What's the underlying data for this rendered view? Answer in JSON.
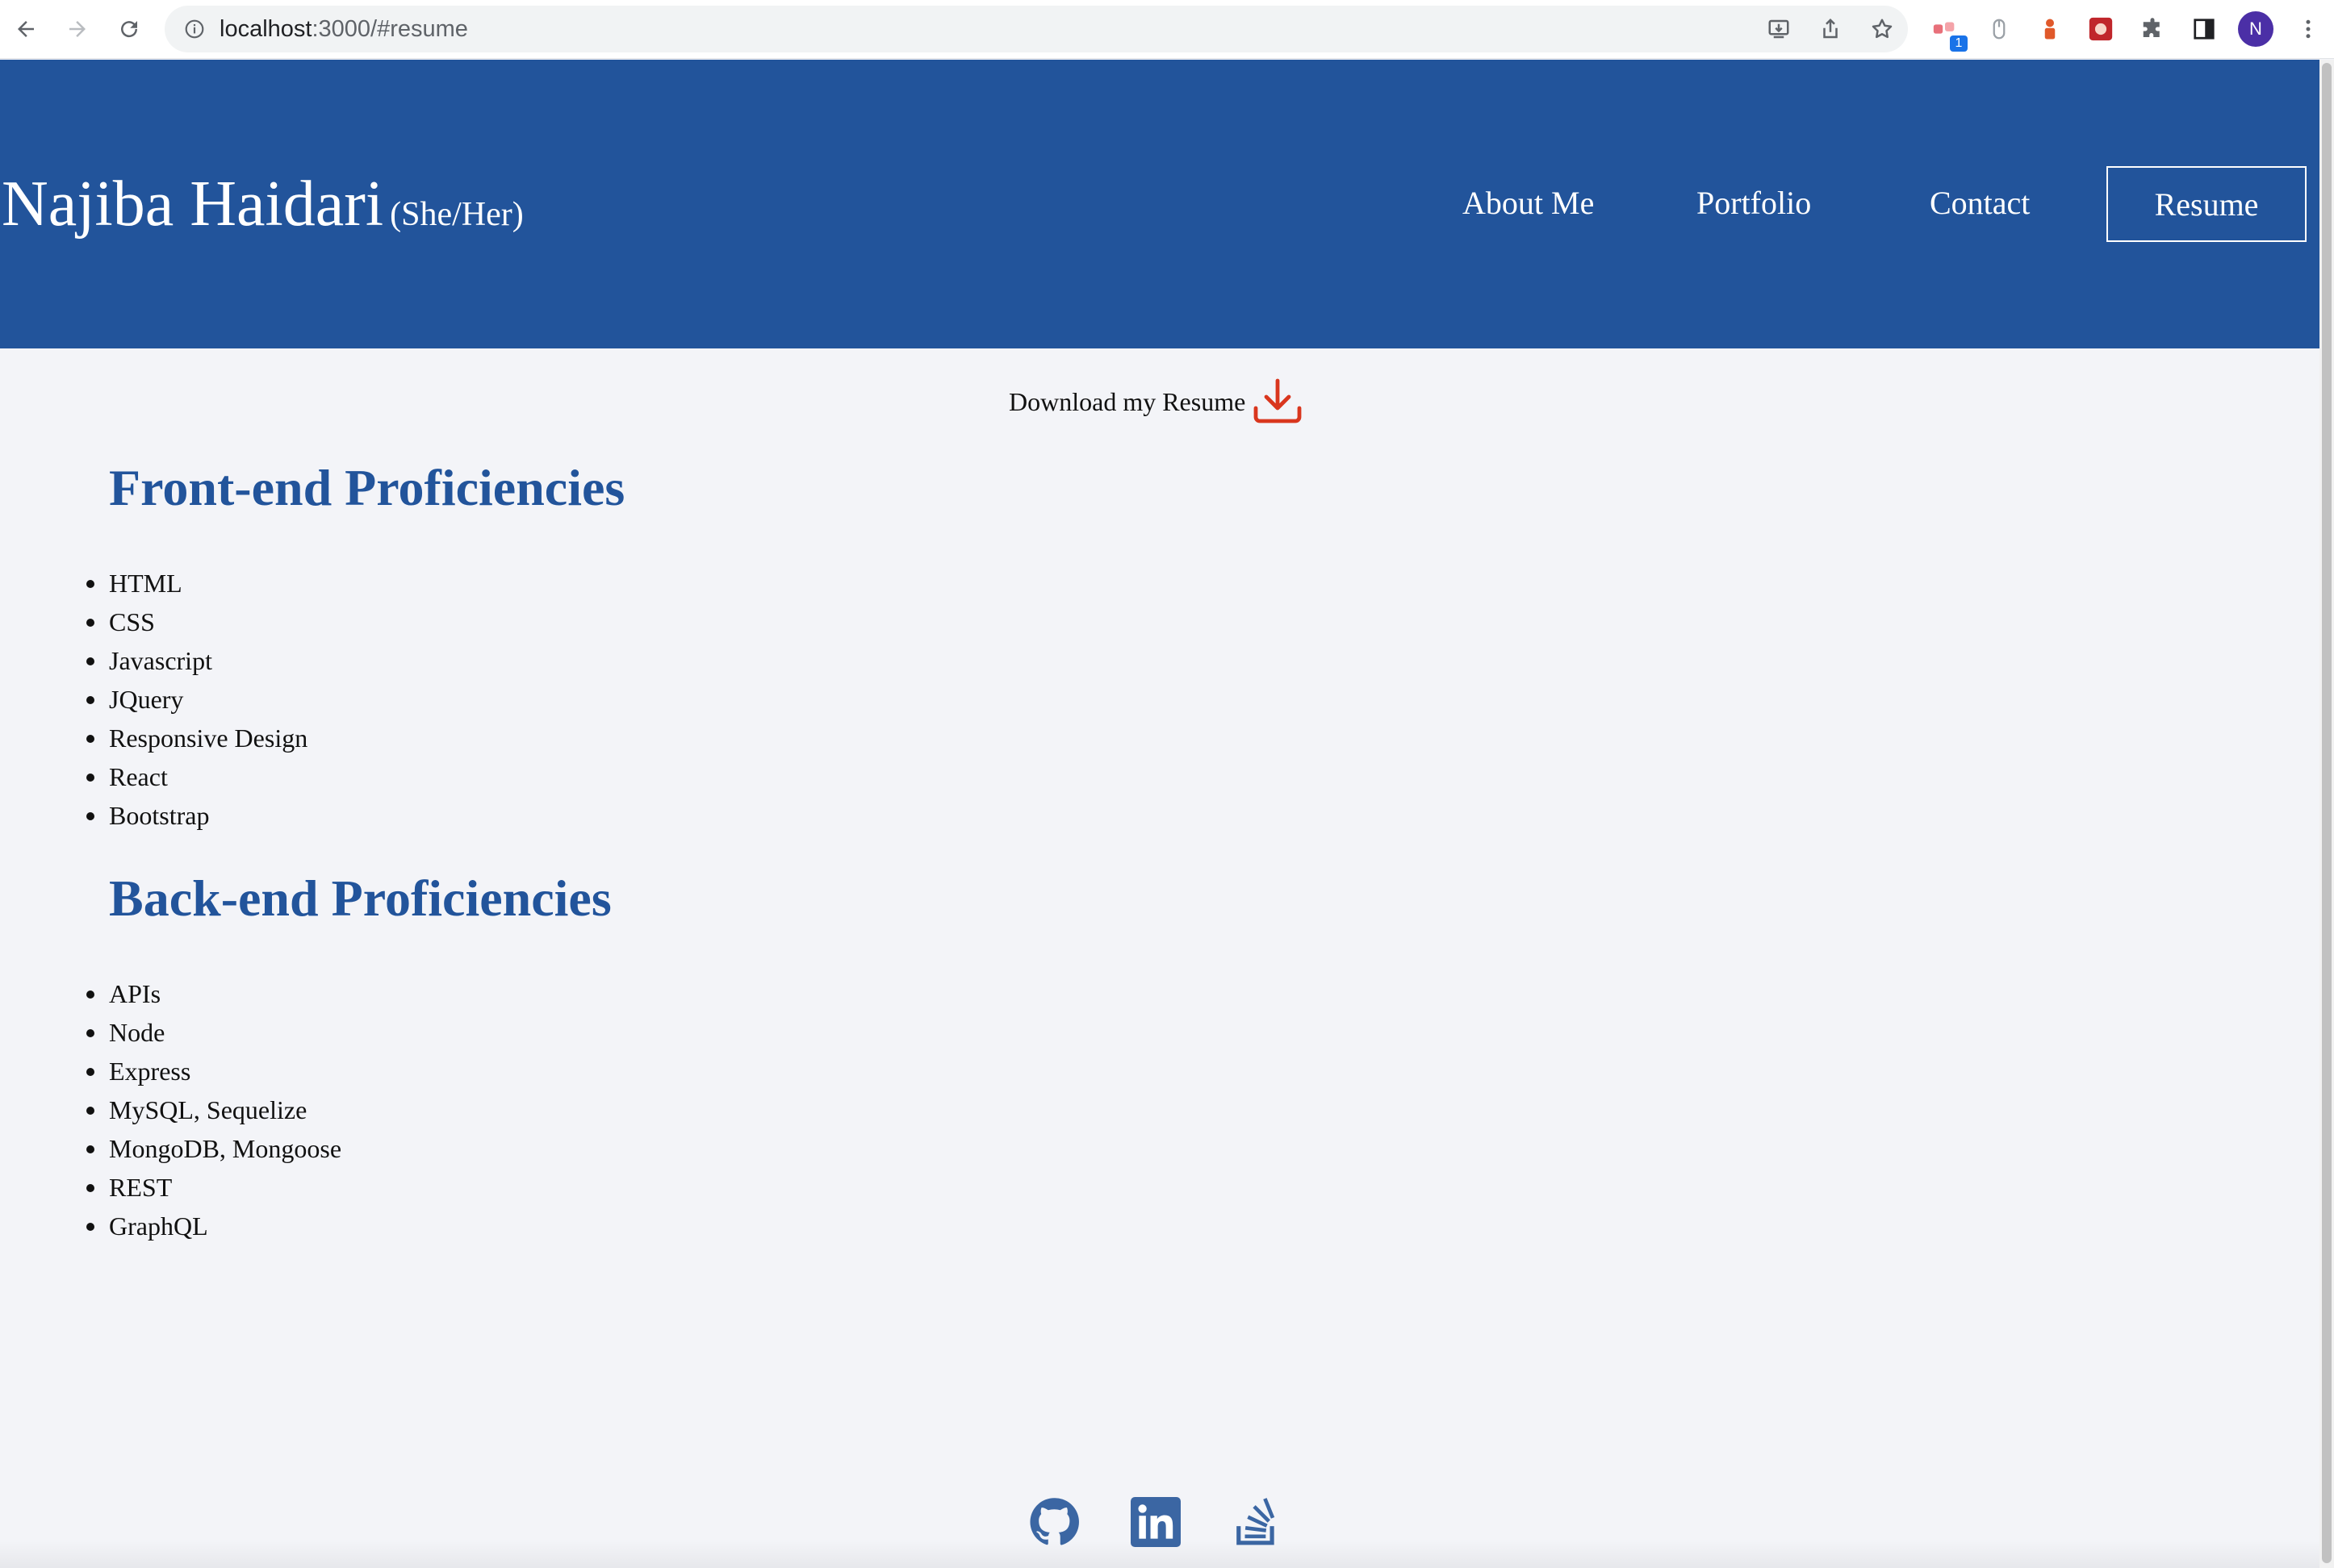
{
  "browser": {
    "url_host": "localhost",
    "url_path": ":3000/#resume",
    "extension_badge": "1",
    "profile_initial": "N"
  },
  "header": {
    "name": "Najiba Haidari",
    "pronouns": "(She/Her)",
    "nav": [
      "About Me",
      "Portfolio",
      "Contact",
      "Resume"
    ],
    "active_nav": "Resume",
    "bg_color": "#22549b"
  },
  "download": {
    "label": "Download my Resume",
    "icon": "download-icon",
    "icon_color": "#d9361e"
  },
  "sections": [
    {
      "title": "Front-end Proficiencies",
      "items": [
        "HTML",
        "CSS",
        "Javascript",
        "JQuery",
        "Responsive Design",
        "React",
        "Bootstrap"
      ]
    },
    {
      "title": "Back-end Proficiencies",
      "items": [
        "APIs",
        "Node",
        "Express",
        "MySQL, Sequelize",
        "MongoDB, Mongoose",
        "REST",
        "GraphQL"
      ]
    }
  ],
  "socials": [
    "github-icon",
    "linkedin-icon",
    "stackoverflow-icon"
  ],
  "colors": {
    "heading": "#22549b",
    "page_bg": "#f3f4f8",
    "social_icon": "#3b66a3"
  }
}
